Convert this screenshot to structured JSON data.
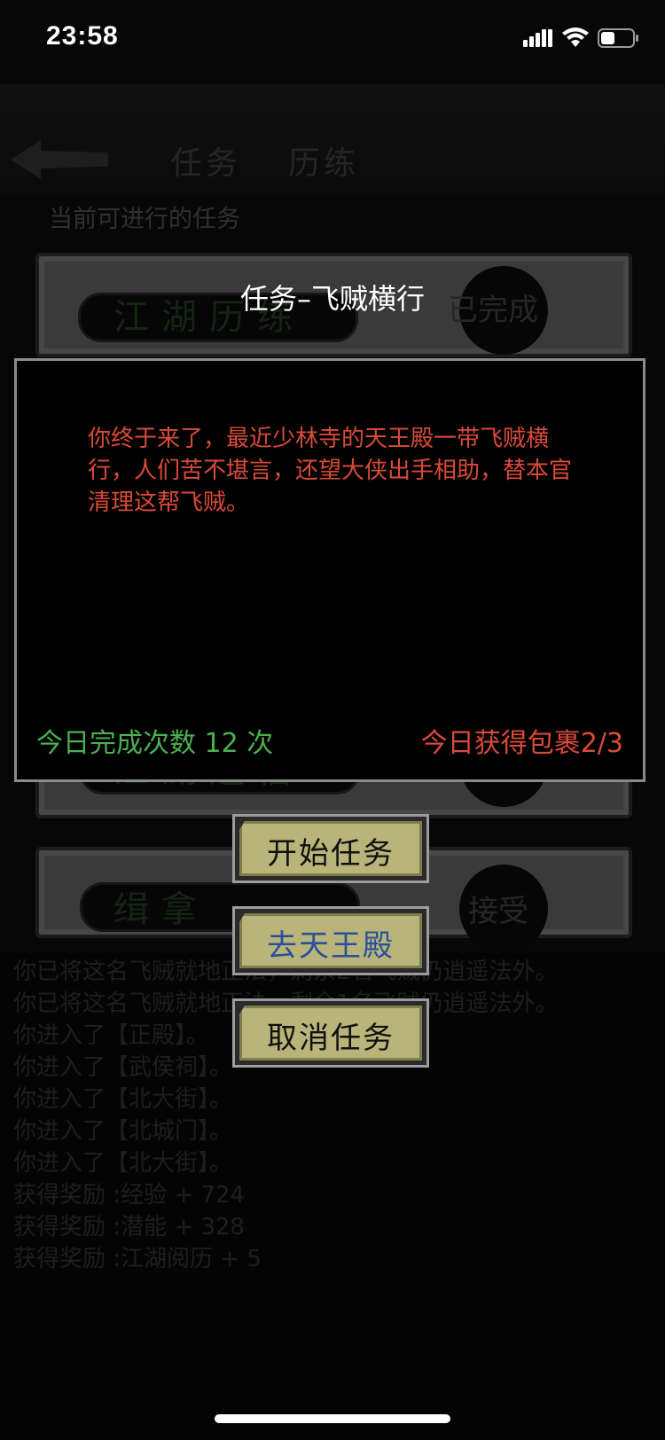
{
  "status_bar": {
    "time": "23:58"
  },
  "background": {
    "tabs": [
      "任务",
      "历练"
    ],
    "subtitle": "当前可进行的任务",
    "cards": [
      {
        "name": "江湖历练",
        "action": "已完成"
      },
      {
        "name": "江湖送信",
        "action": "接受"
      },
      {
        "name": "缉拿",
        "action": "接受"
      }
    ],
    "log": [
      "你已将这名飞贼就地正法，剩余2名飞贼仍逍遥法外。",
      "你已将这名飞贼就地正法，剩余1名飞贼仍逍遥法外。",
      "你进入了【正殿】。",
      "你进入了【武侯祠】。",
      "你进入了【北大街】。",
      "你进入了【北城门】。",
      "你进入了【北大街】。",
      "获得奖励 :经验 + 724",
      "获得奖励 :潜能 + 328",
      "获得奖励 :江湖阅历 + 5"
    ]
  },
  "dialog": {
    "title": "任务–飞贼横行",
    "message": "你终于来了，最近少林寺的天王殿一带飞贼横行，人们苦不堪言，还望大侠出手相助，替本官清理这帮飞贼。",
    "today_count": "今日完成次数 12 次",
    "today_parcel": "今日获得包裹2/3"
  },
  "buttons": {
    "start": "开始任务",
    "goto": "去天王殿",
    "cancel": "取消任务"
  },
  "colors": {
    "message": "#d94a3a",
    "count": "#4caf50",
    "button_face": "#b8b47a",
    "goto_text": "#2a4f9c"
  }
}
